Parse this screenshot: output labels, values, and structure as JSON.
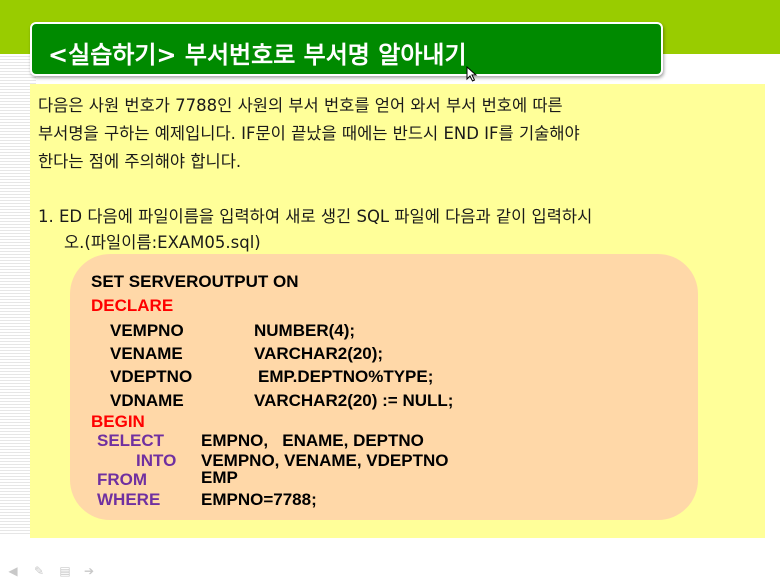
{
  "title": "<실습하기> 부서번호로 부서명 알아내기",
  "intro": {
    "lines": [
      "다음은 사원 번호가 7788인 사원의 부서 번호를 얻어 와서 부서 번호에 따른",
      " 부서명을 구하는 예제입니다. IF문이 끝났을 때에는 반드시 END IF를 기술해야",
      " 한다는 점에 주의해야 합니다."
    ]
  },
  "step1": {
    "line1": "1. ED 다음에 파일이름을 입력하여 새로 생긴 SQL 파일에 다음과 같이 입력하시",
    "line2": "오.(파일이름:EXAM05.sql)"
  },
  "code": {
    "set": "SET SERVEROUTPUT ON",
    "declare": "DECLARE",
    "vars": [
      {
        "name": "VEMPNO",
        "type": "NUMBER(4);"
      },
      {
        "name": "VENAME",
        "type": "VARCHAR2(20);"
      },
      {
        "name": "VDEPTNO",
        "type": "EMP.DEPTNO%TYPE;"
      },
      {
        "name": "VDNAME",
        "type": "VARCHAR2(20) := NULL;"
      }
    ],
    "begin": "BEGIN",
    "select_kw": "SELECT",
    "select_cols": "EMPNO,   ENAME, DEPTNO",
    "into_kw": "INTO",
    "into_vars": "VEMPNO, VENAME, VDEPTNO",
    "from_kw": "FROM",
    "from_table": "EMP",
    "where_kw": "WHERE",
    "where_cond": "EMPNO=7788;"
  },
  "colors": {
    "top_band": "#99cc00",
    "title_bar": "#008a00",
    "content_bg": "#ffff99",
    "code_bg": "#ffd8a8",
    "keyword_red": "#ff0000",
    "keyword_purple": "#7030a0"
  },
  "nav_icons": [
    "prev-icon",
    "pen-icon",
    "menu-icon",
    "next-icon"
  ]
}
